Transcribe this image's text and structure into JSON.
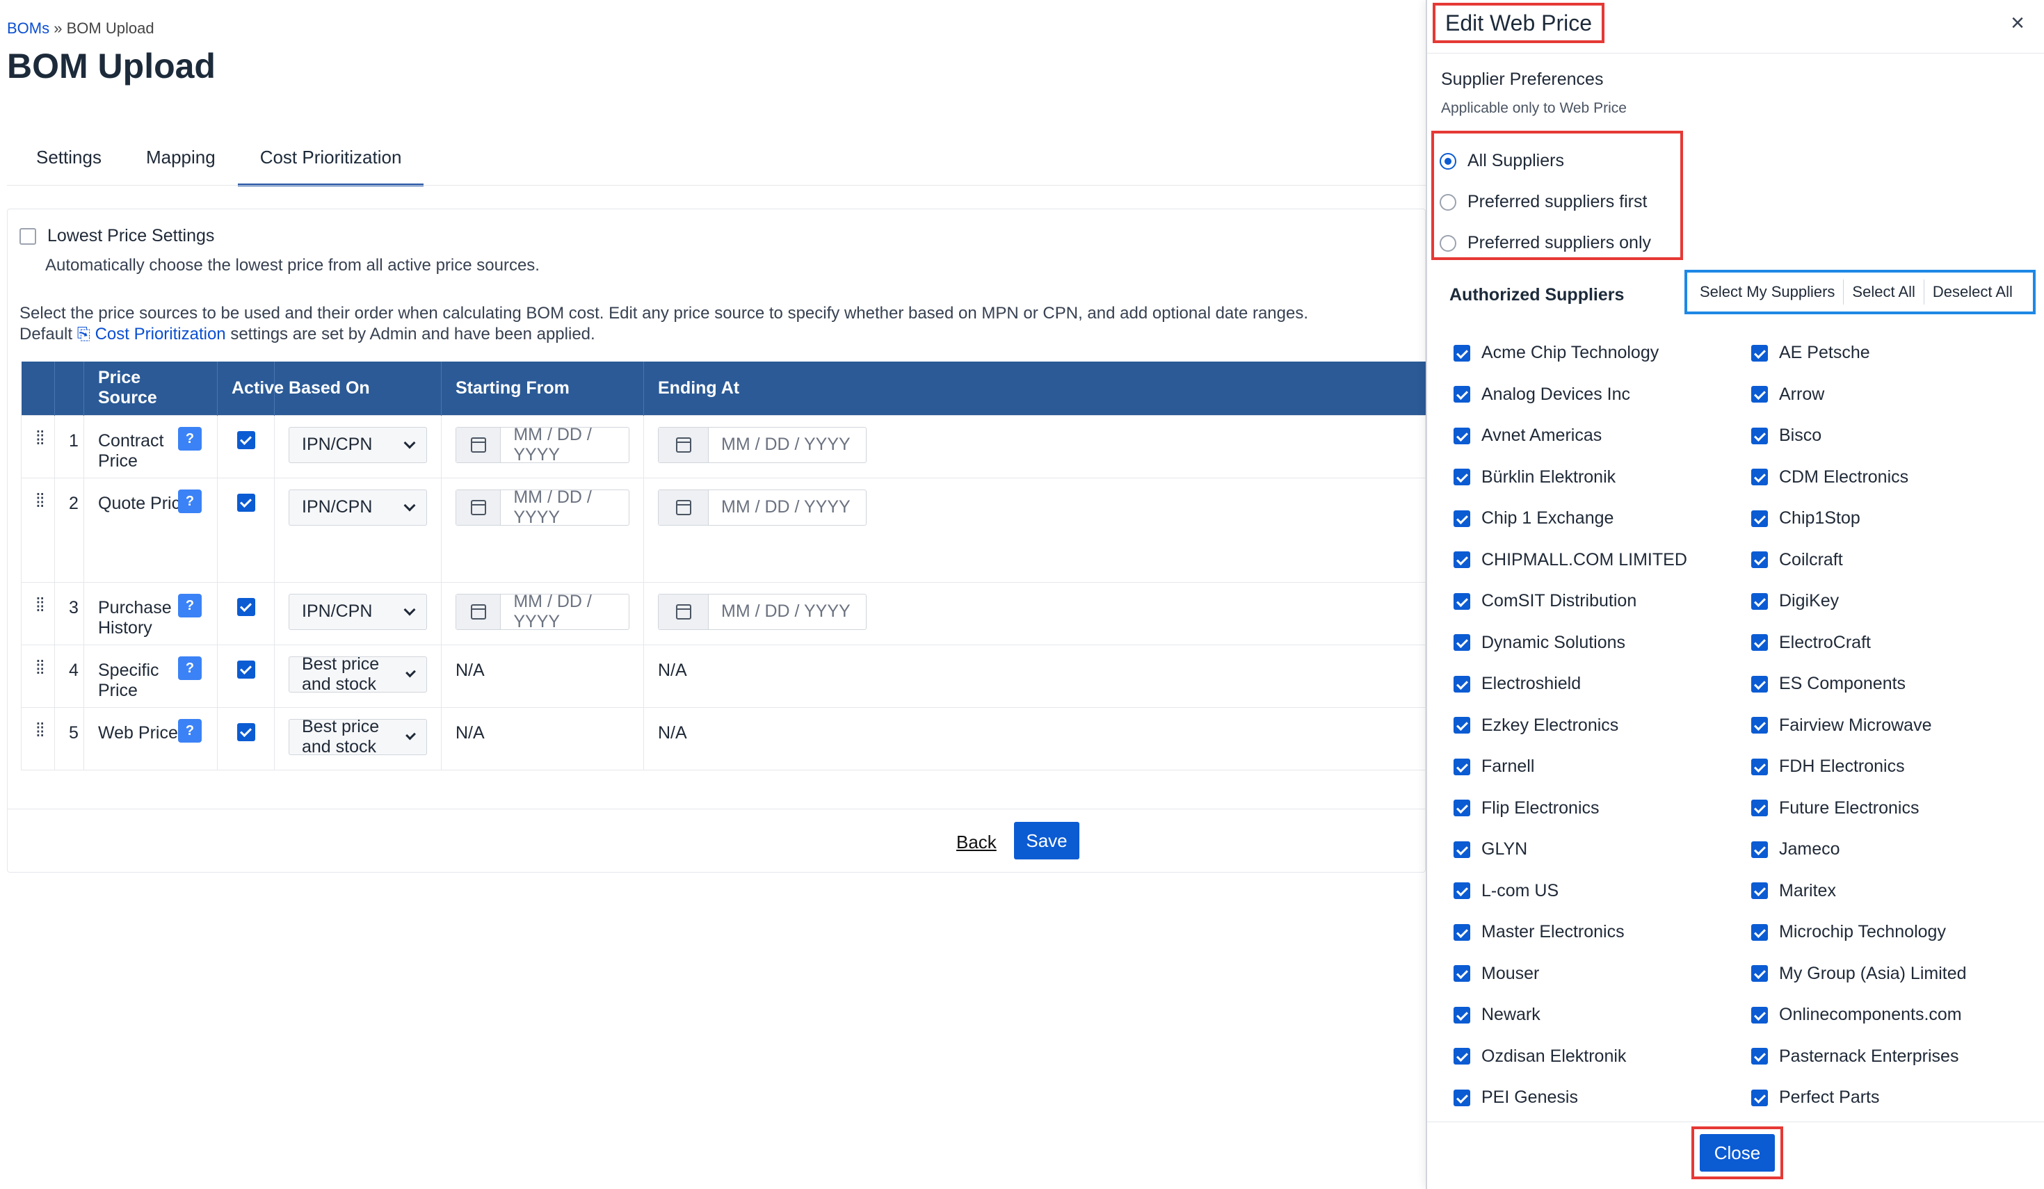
{
  "breadcrumb": {
    "root": "BOMs",
    "separator": "»",
    "current": "BOM Upload"
  },
  "page_title": "BOM Upload",
  "tabs": [
    "Settings",
    "Mapping",
    "Cost Prioritization"
  ],
  "lowest": {
    "label": "Lowest Price Settings",
    "desc": "Automatically choose the lowest price from all active price sources."
  },
  "instructions": {
    "line1": "Select the price sources to be used and their order when calculating BOM cost. Edit any price source to specify whether based on MPN or CPN, and add optional date ranges.",
    "prefix": "Default",
    "link": "Cost Prioritization",
    "suffix": "settings are set by Admin and have been applied."
  },
  "table": {
    "headers": [
      "",
      "",
      "Price Source",
      "Active",
      "Based On",
      "Starting From",
      "Ending At"
    ],
    "help_glyph": "?",
    "rows": [
      {
        "num": "1",
        "source": "Contract Price",
        "based_on": "IPN/CPN",
        "start": "MM / DD / YYYY",
        "end": "MM / DD / YYYY"
      },
      {
        "num": "2",
        "source": "Quote Price",
        "based_on": "IPN/CPN",
        "start": "MM / DD / YYYY",
        "end": "MM / DD / YYYY"
      },
      {
        "num": "3",
        "source": "Purchase History",
        "based_on": "IPN/CPN",
        "start": "MM / DD / YYYY",
        "end": "MM / DD / YYYY"
      },
      {
        "num": "4",
        "source": "Specific Price",
        "based_on": "Best price and stock",
        "start": "N/A",
        "end": "N/A"
      },
      {
        "num": "5",
        "source": "Web Price",
        "based_on": "Best price and stock",
        "start": "N/A",
        "end": "N/A"
      }
    ]
  },
  "actions": {
    "back": "Back",
    "save": "Save"
  },
  "drawer": {
    "title": "Edit Web Price",
    "close_glyph": "×",
    "pref_title": "Supplier Preferences",
    "pref_sub": "Applicable only to Web Price",
    "radios": [
      "All Suppliers",
      "Preferred suppliers first",
      "Preferred suppliers only"
    ],
    "selected_radio": "All Suppliers",
    "auth_title": "Authorized Suppliers",
    "select_my": "Select My Suppliers",
    "select_all": "Select All",
    "deselect_all": "Deselect All",
    "suppliers": [
      "Acme Chip Technology",
      "AE Petsche",
      "Analog Devices Inc",
      "Arrow",
      "Avnet Americas",
      "Bisco",
      "Bürklin Elektronik",
      "CDM Electronics",
      "Chip 1 Exchange",
      "Chip1Stop",
      "CHIPMALL.COM LIMITED",
      "Coilcraft",
      "ComSIT Distribution",
      "DigiKey",
      "Dynamic Solutions",
      "ElectroCraft",
      "Electroshield",
      "ES Components",
      "Ezkey Electronics",
      "Fairview Microwave",
      "Farnell",
      "FDH Electronics",
      "Flip Electronics",
      "Future Electronics",
      "GLYN",
      "Jameco",
      "L-com US",
      "Maritex",
      "Master Electronics",
      "Microchip Technology",
      "Mouser",
      "My Group (Asia) Limited",
      "Newark",
      "Onlinecomponents.com",
      "Ozdisan Elektronik",
      "Pasternack Enterprises",
      "PEI Genesis",
      "Perfect Parts"
    ],
    "close_label": "Close"
  },
  "colors": {
    "accent": "#0b5bd3",
    "header": "#2b5a96",
    "highlight_red": "#e53935",
    "highlight_blue": "#1e88e5"
  }
}
